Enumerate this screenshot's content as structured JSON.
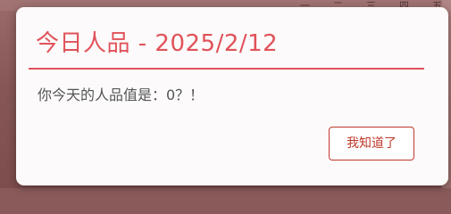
{
  "background": {
    "weekday_labels": [
      "一",
      "二",
      "三",
      "四",
      "五"
    ]
  },
  "dialog": {
    "title": "今日人品 - 2025/2/12",
    "message": "你今天的人品值是：0？！",
    "ok_label": "我知道了",
    "accent_color": "#e0525a",
    "button_color": "#c0392b"
  }
}
